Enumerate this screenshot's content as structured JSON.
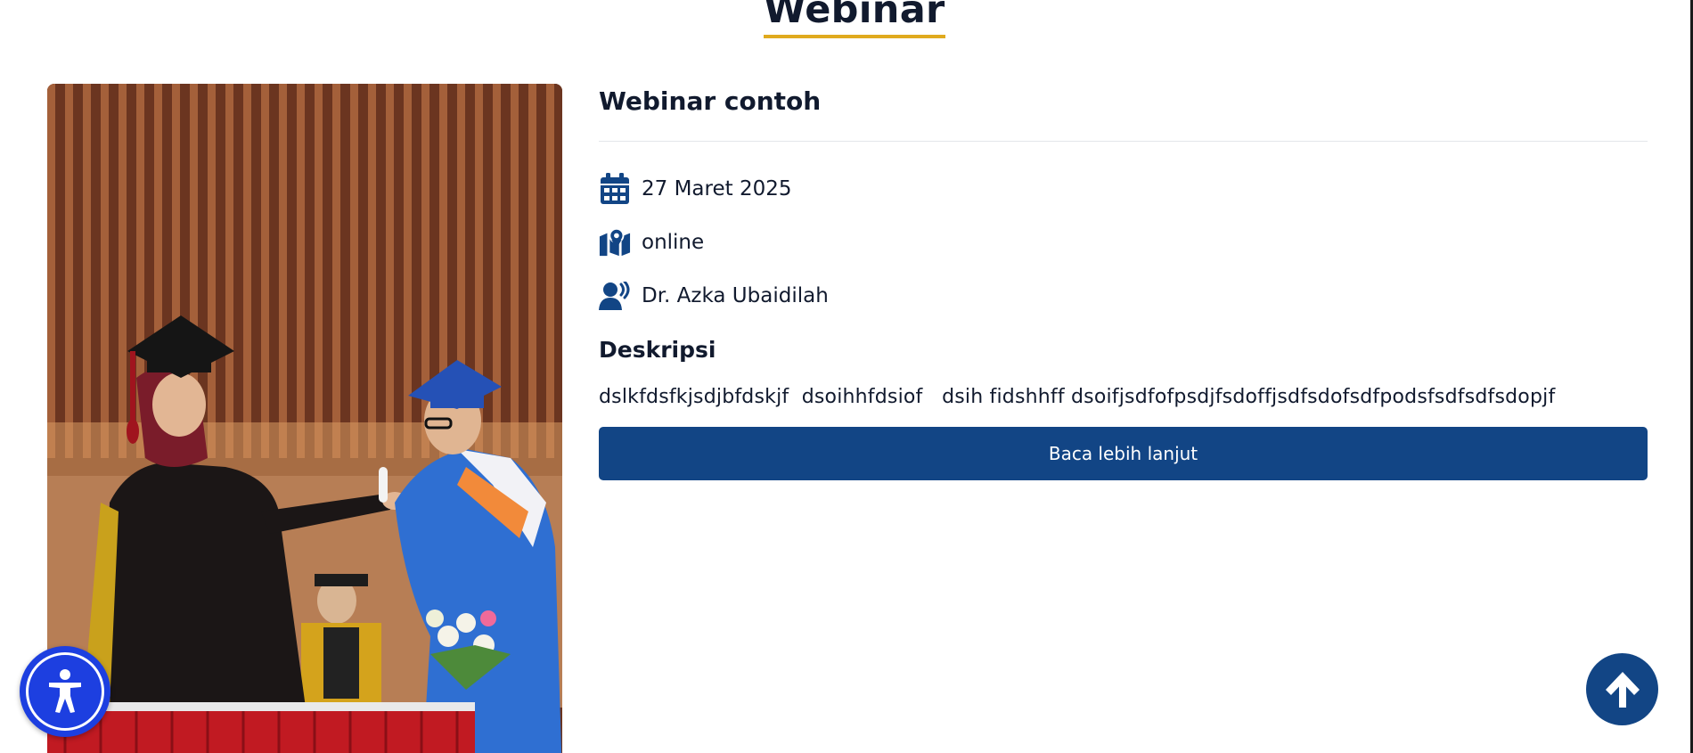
{
  "section": {
    "title": "Webinar"
  },
  "event": {
    "title": "Webinar contoh",
    "date": "27 Maret 2025",
    "location": "online",
    "speaker": "Dr. Azka Ubaidilah",
    "description_heading": "Deskripsi",
    "description": "dslkfdsfkjsdjbfdskjf  dsoihhfdsiof   dsih fidshhff dsoifjsdfofpsdjfsdoffjsdfsdofsdfpodsfsdfsdfsdopjf",
    "read_more_label": "Baca lebih lanjut",
    "image": "graduation-ceremony-photo"
  },
  "icons": {
    "date": "calendar-icon",
    "location": "map-pin-icon",
    "speaker": "speaker-icon",
    "accessibility": "accessibility-icon",
    "back_to_top": "arrow-up-icon"
  },
  "colors": {
    "primary": "#124585",
    "accent_underline": "#e0aa1e",
    "accessibility_button": "#1d3fe0",
    "text": "#111a2e"
  }
}
